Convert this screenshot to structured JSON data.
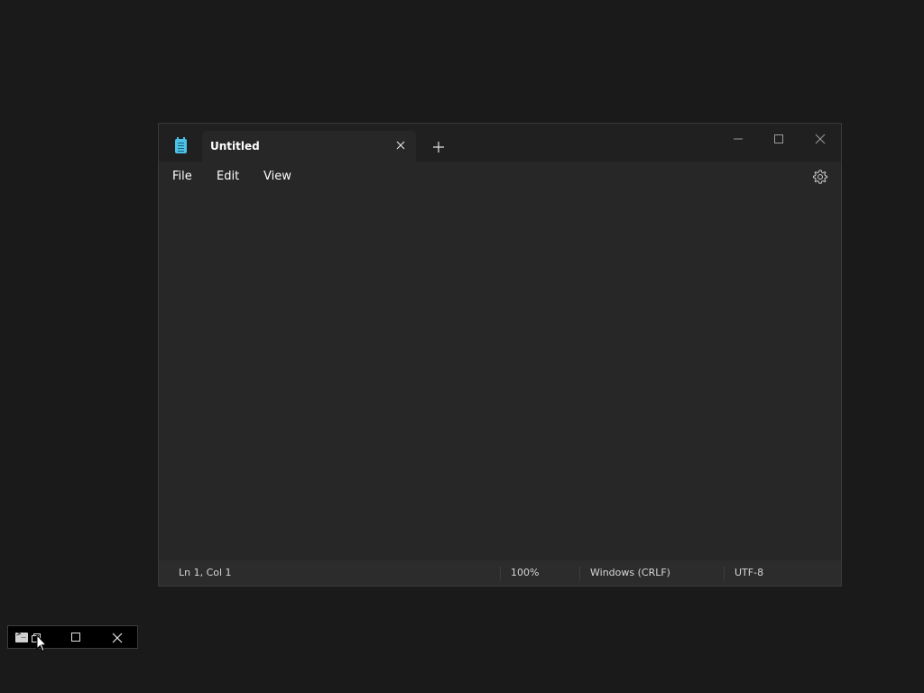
{
  "window": {
    "tab_title": "Untitled",
    "menu": {
      "file": "File",
      "edit": "Edit",
      "view": "View"
    },
    "editor_text": "",
    "status": {
      "position": "Ln 1, Col 1",
      "zoom": "100%",
      "line_ending": "Windows (CRLF)",
      "encoding": "UTF-8"
    }
  },
  "icons": {
    "app": "notepad-icon",
    "tab_close": "close-icon",
    "new_tab": "plus-icon",
    "minimize": "minimize-icon",
    "maximize": "maximize-icon",
    "close": "close-icon",
    "settings": "gear-icon",
    "mini_terminal": "terminal-icon",
    "mini_restore": "restore-icon",
    "mini_maximize": "maximize-icon",
    "mini_close": "close-icon"
  },
  "colors": {
    "desktop": "#1a1a1a",
    "titlebar": "#202020",
    "surface": "#272727",
    "statusbar": "#2c2c2c",
    "accent_icon": "#4cc2e6",
    "text": "#ffffff"
  }
}
